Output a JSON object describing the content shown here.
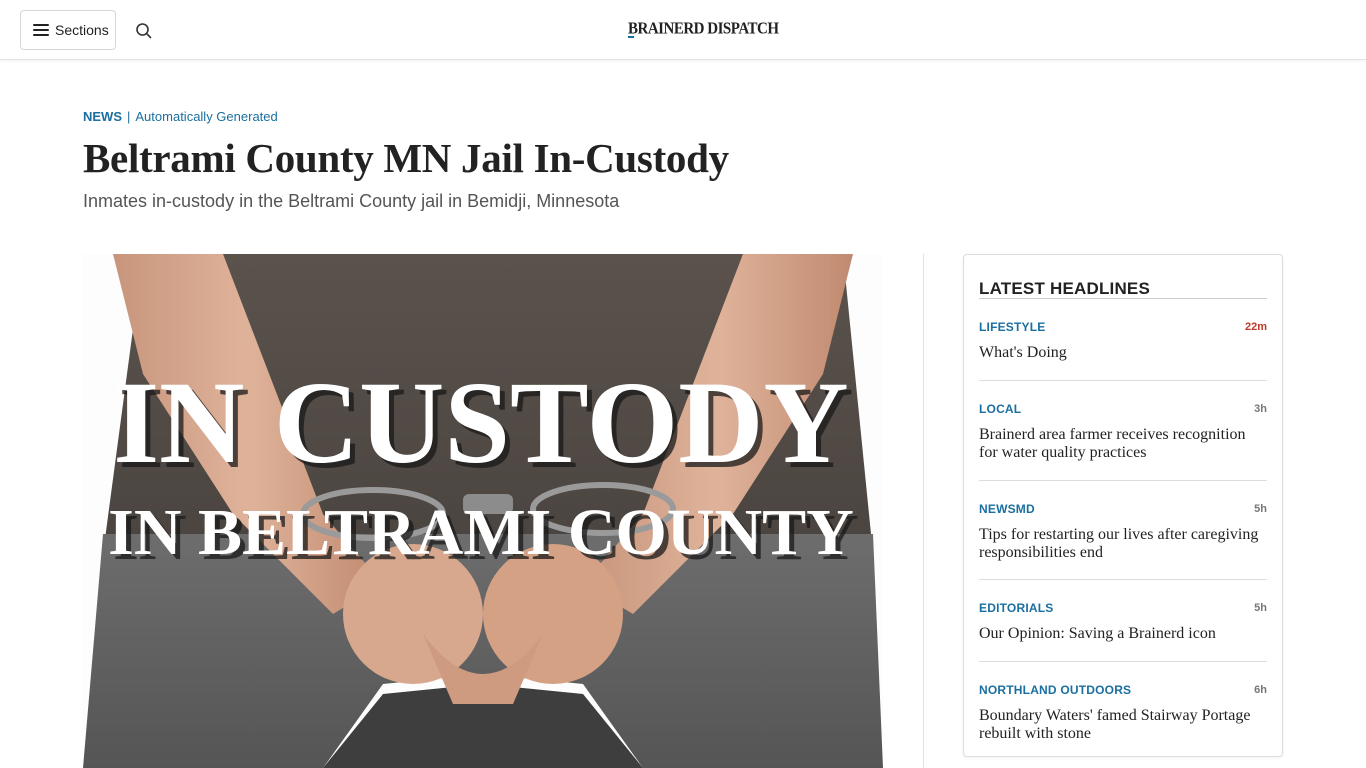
{
  "header": {
    "sections_label": "Sections",
    "search_icon": "search-icon",
    "menu_icon": "hamburger-icon",
    "logo_text": "BRAINERD DISPATCH"
  },
  "article": {
    "category": "NEWS",
    "separator": "|",
    "tag": "Automatically Generated",
    "title": "Beltrami County MN Jail In-Custody",
    "subtitle": "Inmates in-custody in the Beltrami County jail in Bemidji, Minnesota",
    "image_caption_line1": "IN CUSTODY",
    "image_caption_line2": "IN BELTRAMI COUNTY"
  },
  "sidebar": {
    "title": "LATEST HEADLINES",
    "items": [
      {
        "category": "LIFESTYLE",
        "time": "22m",
        "headline": "What's Doing"
      },
      {
        "category": "LOCAL",
        "time": "3h",
        "headline": "Brainerd area farmer receives recognition for water quality practices"
      },
      {
        "category": "NEWSMD",
        "time": "5h",
        "headline": "Tips for restarting our lives after caregiving responsibilities end"
      },
      {
        "category": "EDITORIALS",
        "time": "5h",
        "headline": "Our Opinion: Saving a Brainerd icon"
      },
      {
        "category": "NORTHLAND OUTDOORS",
        "time": "6h",
        "headline": "Boundary Waters' famed Stairway Portage rebuilt with stone"
      }
    ]
  },
  "colors": {
    "accent": "#1a6fa0",
    "fresh_time": "#c0392b"
  }
}
